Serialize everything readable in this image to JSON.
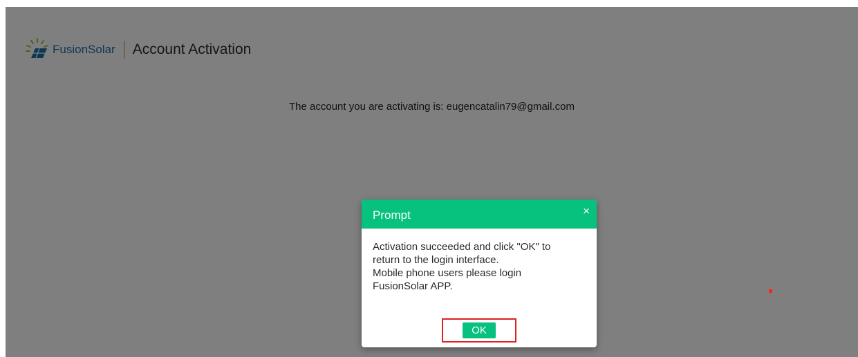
{
  "header": {
    "brand": "FusionSolar",
    "title": "Account Activation"
  },
  "main": {
    "account_text": "The account you are activating is: eugencatalin79@gmail.com"
  },
  "dialog": {
    "title": "Prompt",
    "close_icon": "×",
    "message_lines": [
      "Activation succeeded and click \"OK\" to",
      "return to the login interface.",
      "Mobile phone users please login",
      "FusionSolar APP."
    ],
    "ok_label": "OK"
  },
  "colors": {
    "accent": "#07c17e",
    "brand": "#1d6fa5",
    "highlight": "#e02020",
    "overlay": "rgba(0,0,0,0.5)"
  }
}
